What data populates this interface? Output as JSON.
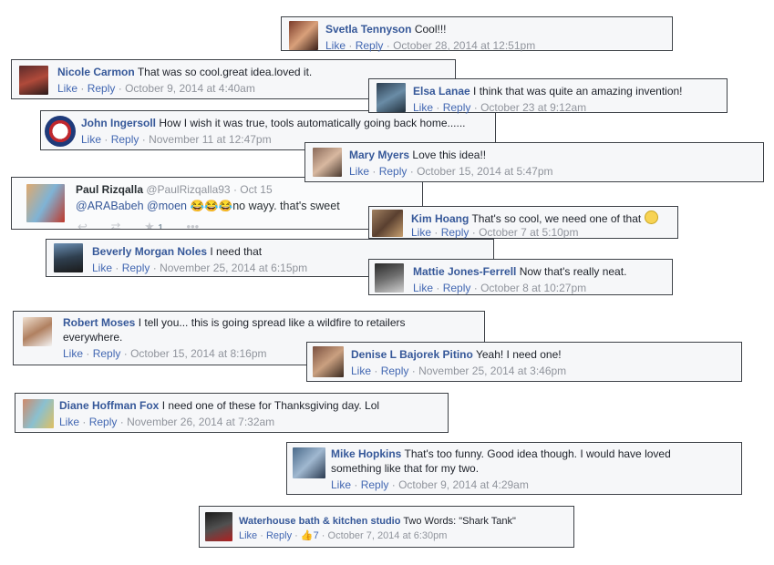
{
  "actions": {
    "like": "Like",
    "reply": "Reply",
    "dot": "·"
  },
  "comments": [
    {
      "name": "Svetla Tennyson",
      "text": "Cool!!!",
      "time": "October 28, 2014 at 12:51pm"
    },
    {
      "name": "Nicole Carmon",
      "text": "That was so cool.great idea.loved it.",
      "time": "October 9, 2014 at 4:40am"
    },
    {
      "name": "Elsa Lanae",
      "text": "I think that was quite an amazing invention!",
      "time": "October 23 at 9:12am"
    },
    {
      "name": "John Ingersoll",
      "text": "How I wish it was true, tools automatically going back home......",
      "time": "November 11 at 12:47pm"
    },
    {
      "name": "Mary Myers",
      "text": "Love this idea!!",
      "time": "October 15, 2014 at 5:47pm"
    },
    {
      "name": "Kim Hoang",
      "text": "That's so cool, we need one of that",
      "time": "October 7 at 5:10pm"
    },
    {
      "name": "Beverly Morgan Noles",
      "text": "I need that",
      "time": "November 25, 2014 at 6:15pm"
    },
    {
      "name": "Mattie Jones-Ferrell",
      "text": "Now that's really neat.",
      "time": "October 8 at 10:27pm"
    },
    {
      "name": "Robert Moses",
      "text": "I tell you... this is going spread like a wildfire to retailers",
      "text2": "everywhere.",
      "time": "October 15, 2014 at 8:16pm"
    },
    {
      "name": "Denise L Bajorek Pitino",
      "text": "Yeah! I need one!",
      "time": "November 25, 2014 at 3:46pm"
    },
    {
      "name": "Diane Hoffman Fox",
      "text": "I need one of these for Thanksgiving day. Lol",
      "time": "November 26, 2014 at 7:32am"
    },
    {
      "name": "Mike Hopkins",
      "text": "That's too funny. Good idea though. I would have loved",
      "text2": "something like that for my two.",
      "time": "October 9, 2014 at 4:29am"
    },
    {
      "name": "Waterhouse bath & kitchen studio",
      "text": "Two Words: \"Shark Tank\"",
      "likes": "7",
      "time": "October 7, 2014 at 6:30pm"
    }
  ],
  "tweet": {
    "name": "Paul Rizqalla",
    "handle": "@PaulRizqalla93",
    "date": "Oct 15",
    "mention1": "@ARABabeh",
    "mention2": "@moen",
    "emoji": "😂😂😂",
    "text": "no wayy. that's sweet",
    "fav_count": "1"
  },
  "colors": {
    "name": "#365899",
    "action": "#4267b2",
    "meta": "#90949c",
    "card": "#f6f7f9",
    "border": "#3b3f45"
  }
}
